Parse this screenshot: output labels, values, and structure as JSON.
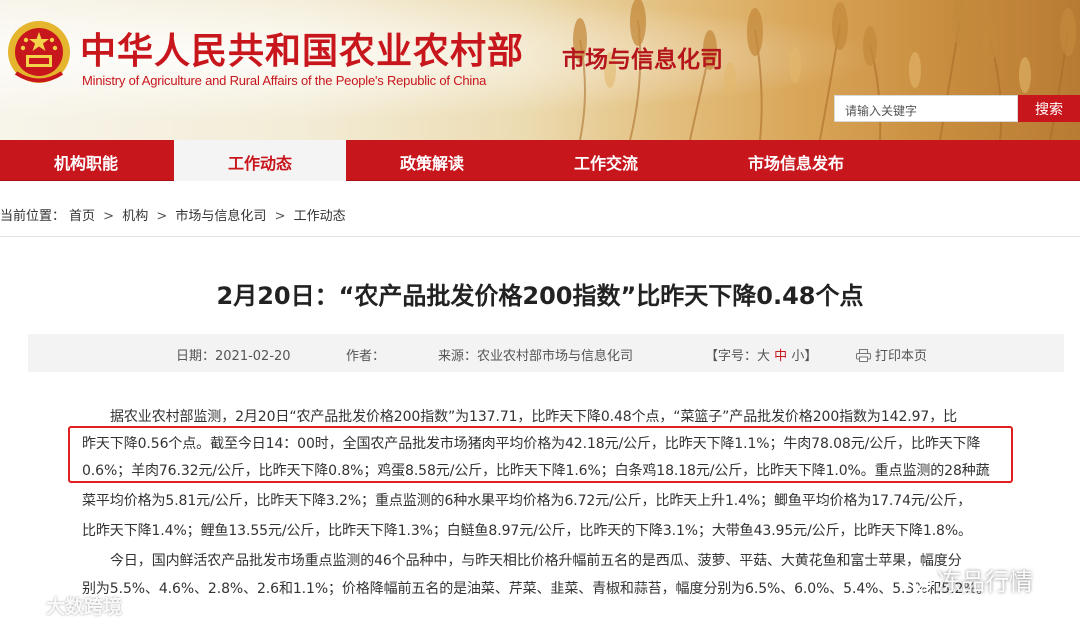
{
  "header": {
    "ministry_cn": "中华人民共和国农业农村部",
    "ministry_en": "Ministry of Agriculture and Rural Affairs of the People's Republic of China",
    "department": "市场与信息化司",
    "search_placeholder": "请输入关键字",
    "search_label": "搜索"
  },
  "nav": {
    "items": [
      {
        "label": "机构职能"
      },
      {
        "label": "工作动态"
      },
      {
        "label": "政策解读"
      },
      {
        "label": "工作交流"
      },
      {
        "label": "市场信息发布"
      }
    ],
    "active_index": 1
  },
  "breadcrumb": {
    "prefix": "当前位置：",
    "items": [
      "首页",
      "机构",
      "市场与信息化司",
      "工作动态"
    ],
    "separator": ">"
  },
  "article": {
    "title": "2月20日：“农产品批发价格200指数”比昨天下降0.48个点",
    "meta": {
      "date": "日期：2021-02-20",
      "author": "作者：",
      "source": "来源：农业农村部市场与信息化司",
      "font_size_prefix": "【字号：",
      "font_large": "大",
      "font_medium": "中",
      "font_small": "小",
      "font_size_suffix": "】",
      "print": "打印本页"
    },
    "lines": [
      "据农业农村部监测，2月20日“农产品批发价格200指数”为137.71，比昨天下降0.48个点，“菜篮子”产品批发价格200指数为142.97，比",
      "昨天下降0.56个点。截至今日14：00时，全国农产品批发市场猪肉平均价格为42.18元/公斤，比昨天下降1.1%；牛肉78.08元/公斤，比昨天下降",
      "0.6%；羊肉76.32元/公斤，比昨天下降0.8%；鸡蛋8.58元/公斤，比昨天下降1.6%；白条鸡18.18元/公斤，比昨天下降1.0%。重点监测的28种蔬",
      "菜平均价格为5.81元/公斤，比昨天下降3.2%；重点监测的6种水果平均价格为6.72元/公斤，比昨天上升1.4%；鲫鱼平均价格为17.74元/公斤，",
      "比昨天下降1.4%；鲤鱼13.55元/公斤，比昨天下降1.3%；白鲢鱼8.97元/公斤，比昨天的下降3.1%；大带鱼43.95元/公斤，比昨天下降1.8%。",
      "今日，国内鲜活农产品批发市场重点监测的46个品种中，与昨天相比价格升幅前五名的是西瓜、菠萝、平菇、大黄花鱼和富士苹果，幅度分",
      "别为5.5%、4.6%、2.8%、2.6和1.1%；价格降幅前五名的是油菜、芹菜、韭菜、青椒和蒜苔，幅度分别为6.5%、6.0%、5.4%、5.3%和5.2%。"
    ]
  },
  "watermarks": {
    "left": "大数跨境",
    "right": "冻品行情"
  },
  "colors": {
    "brand_red": "#c8161d",
    "highlight_border": "#e02020"
  }
}
